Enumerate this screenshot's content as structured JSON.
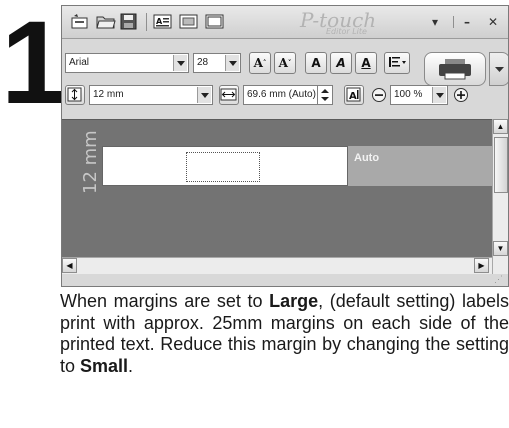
{
  "step_number": "1",
  "app": {
    "brand": "P-touch",
    "brand_sub": "Editor Lite"
  },
  "titlebar": {
    "menu_glyph": "▾",
    "minimize_glyph": "–",
    "close_glyph": "✕"
  },
  "toolbar1": {
    "font_name": "Arial",
    "font_size": "28",
    "grow_label": "A",
    "shrink_label": "A",
    "bold_label": "A",
    "italic_label": "A",
    "underline_label": "A"
  },
  "toolbar2": {
    "tape_width": "12 mm",
    "label_length": "69.6 mm (Auto)",
    "zoom": "100 %"
  },
  "canvas": {
    "ruler_label": "12 mm",
    "auto_label": "Auto",
    "background": "#737373"
  },
  "icons": [
    "new-label-icon",
    "open-icon",
    "save-icon",
    "text-icon",
    "frame-icon",
    "image-icon",
    "increase-font-icon",
    "decrease-font-icon",
    "bold-icon",
    "italic-icon",
    "underline-icon",
    "alignment-icon",
    "print-icon",
    "tape-width-icon",
    "label-length-icon",
    "auto-fit-icon",
    "zoom-out-icon",
    "zoom-in-icon"
  ],
  "description": {
    "part1": "When margins are set to ",
    "large": "Large",
    "part2": ", (default setting) labels print with approx. 25mm margins on each side of the printed text. Reduce this margin by changing the setting to ",
    "small": "Small",
    "part3": "."
  }
}
